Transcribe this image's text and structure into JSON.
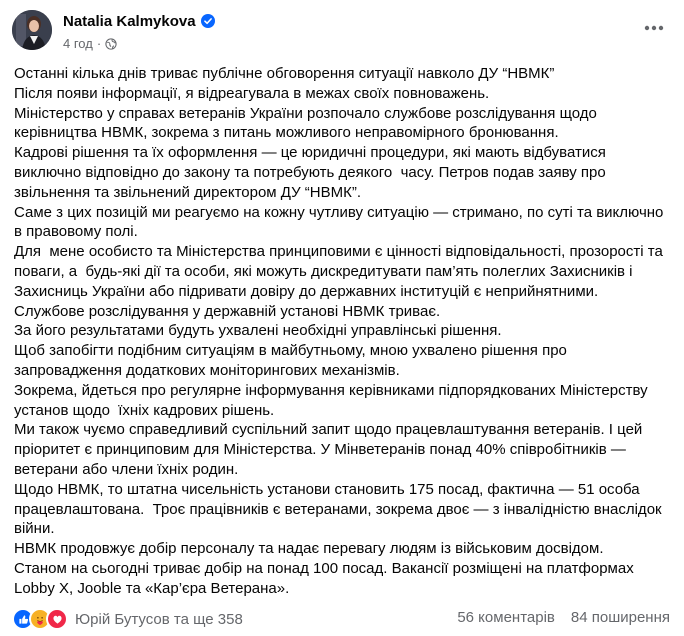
{
  "post": {
    "author_name": "Natalia Kalmykova",
    "timestamp": "4 год",
    "paragraphs": [
      "Останні кілька днів триває публічне обговорення ситуації навколо ДУ “НВМК”",
      "Після появи інформації, я відреагувала в межах своїх повноважень.",
      "Міністерство у справах ветеранів України розпочало службове розслідування щодо керівництва НВМК, зокрема з питань можливого неправомірного бронювання.",
      "Кадрові рішення та їх оформлення — це юридичні процедури, які мають відбуватися виключно відповідно до закону та потребують деякого  часу. Петров подав заяву про звільнення та звільнений директором ДУ “НВМК”.",
      "Саме з цих позицій ми реагуємо на кожну чутливу ситуацію — стримано, по суті та виключно в правовому полі.",
      "Для  мене особисто та Міністерства принциповими є цінності відповідальності, прозорості та поваги, а  будь-які дії та особи, які можуть дискредитувати пам’ять полеглих Захисників і Захисниць України або підривати довіру до державних інституцій є неприйнятними.",
      "Службове розслідування у державній установі НВМК триває.",
      "За його результатами будуть ухвалені необхідні управлінські рішення.",
      "Щоб запобігти подібним ситуаціям в майбутньому, мною ухвалено рішення про запровадження додаткових моніторингових механізмів.",
      "Зокрема, йдеться про регулярне інформування керівниками підпорядкованих Міністерству установ щодо  їхніх кадрових рішень.",
      "Ми також чуємо справедливий суспільний запит щодо працевлаштування ветеранів. І цей пріоритет є принциповим для Міністерства. У Мінветеранів понад 40% співробітників — ветерани або члени їхніх родин.",
      "Щодо НВМК, то штатна чисельність установи становить 175 посад, фактична — 51 особа працевлаштована.  Троє працівників є ветеранами, зокрема двоє — з інвалідністю внаслідок війни.",
      "НВМК продовжує добір персоналу та надає перевагу людям із військовим досвідом.",
      "Станом на сьогодні триває добір на понад 100 посад. Вакансії розміщені на платформах Lobby X, Jooble та «Кар’єра Ветерана»."
    ]
  },
  "footer": {
    "reactions_text": "Юрій Бутусов та ще 358",
    "comments": "56 коментарів",
    "shares": "84 поширення"
  },
  "icons": {
    "verified": "verified-badge-icon",
    "privacy": "globe-icon",
    "more": "more-options-icon",
    "reactions": [
      "like-icon",
      "care-icon",
      "love-icon"
    ]
  },
  "colors": {
    "accent": "#0866ff",
    "secondary_text": "#65676b",
    "like": "#0866ff",
    "love": "#f02849",
    "care": "#f7b125"
  }
}
